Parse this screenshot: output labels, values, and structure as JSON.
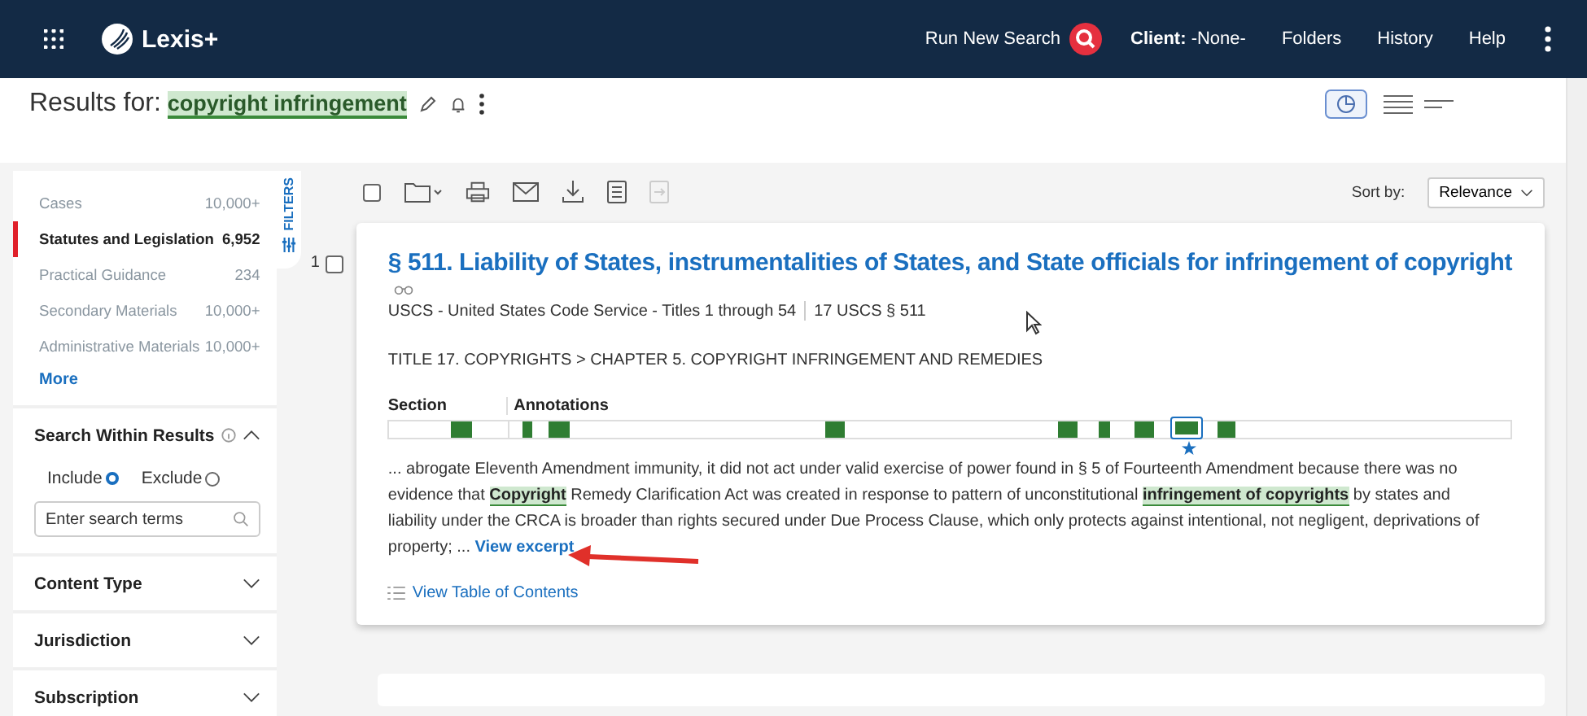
{
  "header": {
    "brand": "Lexis+",
    "nav": [
      {
        "kind": "search",
        "label": "Run New Search"
      },
      {
        "kind": "client",
        "label": "Client:",
        "value": "-None-"
      },
      {
        "kind": "link",
        "label": "Folders"
      },
      {
        "kind": "link",
        "label": "History"
      },
      {
        "kind": "link",
        "label": "Help"
      }
    ]
  },
  "results_for": {
    "label": "Results for:",
    "query": "copyright infringement"
  },
  "sidebar": {
    "categories": [
      {
        "label": "Cases",
        "count": "10,000+",
        "selected": false
      },
      {
        "label": "Statutes and Legislation",
        "count": "6,952",
        "selected": true
      },
      {
        "label": "Practical Guidance",
        "count": "234",
        "selected": false
      },
      {
        "label": "Secondary Materials",
        "count": "10,000+",
        "selected": false
      },
      {
        "label": "Administrative Materials",
        "count": "10,000+",
        "selected": false
      }
    ],
    "more": "More",
    "sections": [
      {
        "kind": "search",
        "title": "Search Within Results",
        "expanded": true,
        "options": [
          {
            "label": "Include",
            "selected": true
          },
          {
            "label": "Exclude",
            "selected": false
          }
        ],
        "placeholder": "Enter search terms"
      },
      {
        "kind": "plain",
        "title": "Content Type",
        "expanded": false
      },
      {
        "kind": "plain",
        "title": "Jurisdiction",
        "expanded": false
      },
      {
        "kind": "plain",
        "title": "Subscription",
        "expanded": false
      }
    ]
  },
  "filters_tab": "FILTERS",
  "toolbar": {
    "select_all_checked": false,
    "sort_label": "Sort by:",
    "sort_value": "Relevance"
  },
  "results": [
    {
      "number": "1",
      "checked": false,
      "title": "§ 511. Liability of States, instrumentalities of States, and State officials for infringement of copyright",
      "source": "USCS - United States Code Service - Titles 1 through 54",
      "citation": "17 USCS § 511",
      "path": "TITLE 17. COPYRIGHTS > CHAPTER 5. COPYRIGHT INFRINGEMENT AND REMEDIES",
      "map_labels": [
        "Section",
        "Annotations"
      ],
      "snippet": [
        {
          "text": "... abrogate Eleventh Amendment immunity, it did not act under valid exercise of power found in § 5 of Fourteenth Amendment because there was no evidence that ",
          "highlight": false
        },
        {
          "text": "Copyright",
          "highlight": true
        },
        {
          "text": " Remedy Clarification Act was created in response to pattern of unconstitutional ",
          "highlight": false
        },
        {
          "text": "infringement of copyrights",
          "highlight": true
        },
        {
          "text": " by states and liability under the CRCA is broader than rights secured under Due Process Clause, which only protects against intentional, not negligent, deprivations of property; ... ",
          "highlight": false
        }
      ],
      "excerpt_link": "View excerpt",
      "toc_link": "View Table of Contents"
    }
  ]
}
